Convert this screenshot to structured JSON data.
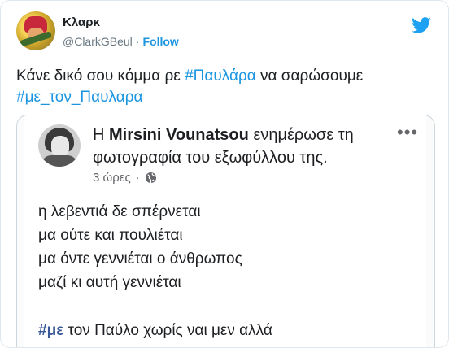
{
  "tweet": {
    "display_name": "Κλαρκ",
    "handle": "@ClarkGBeul",
    "separator": "·",
    "follow_label": "Follow",
    "text_prefix": "Κάνε δικό σου κόμμα ρε ",
    "hashtag_1": "#Παυλάρα",
    "text_middle": " να σαρώσουμε",
    "hashtag_2": "#με_τον_Παυλαρα",
    "icons": {
      "logo": "twitter-bird-icon",
      "avatar": "profile-avatar"
    },
    "colors": {
      "link": "#1b95e0",
      "text": "#1c2022",
      "muted": "#697882"
    }
  },
  "embedded_post": {
    "header_prefix": "Η ",
    "author": "Mirsini Vounatsou",
    "header_suffix": " ενημέρωσε τη φωτογραφία του εξωφύλλου της.",
    "time": "3 ώρες",
    "meta_separator": "·",
    "more_label": "•••",
    "body_lines": [
      "η λεβεντιά δε σπέρνεται",
      "μα ούτε και πουλιέται",
      "μα όντε γεννιέται ο άνθρωπος",
      "μαζί κι αυτή γεννιέται"
    ],
    "hashtag": "#με",
    "hashtag_text": " τον Παύλο χωρίς ναι μεν αλλά",
    "icons": {
      "privacy": "globe-icon",
      "menu": "more-dots-icon"
    },
    "colors": {
      "hashtag": "#385898",
      "meta": "#65676b"
    }
  }
}
